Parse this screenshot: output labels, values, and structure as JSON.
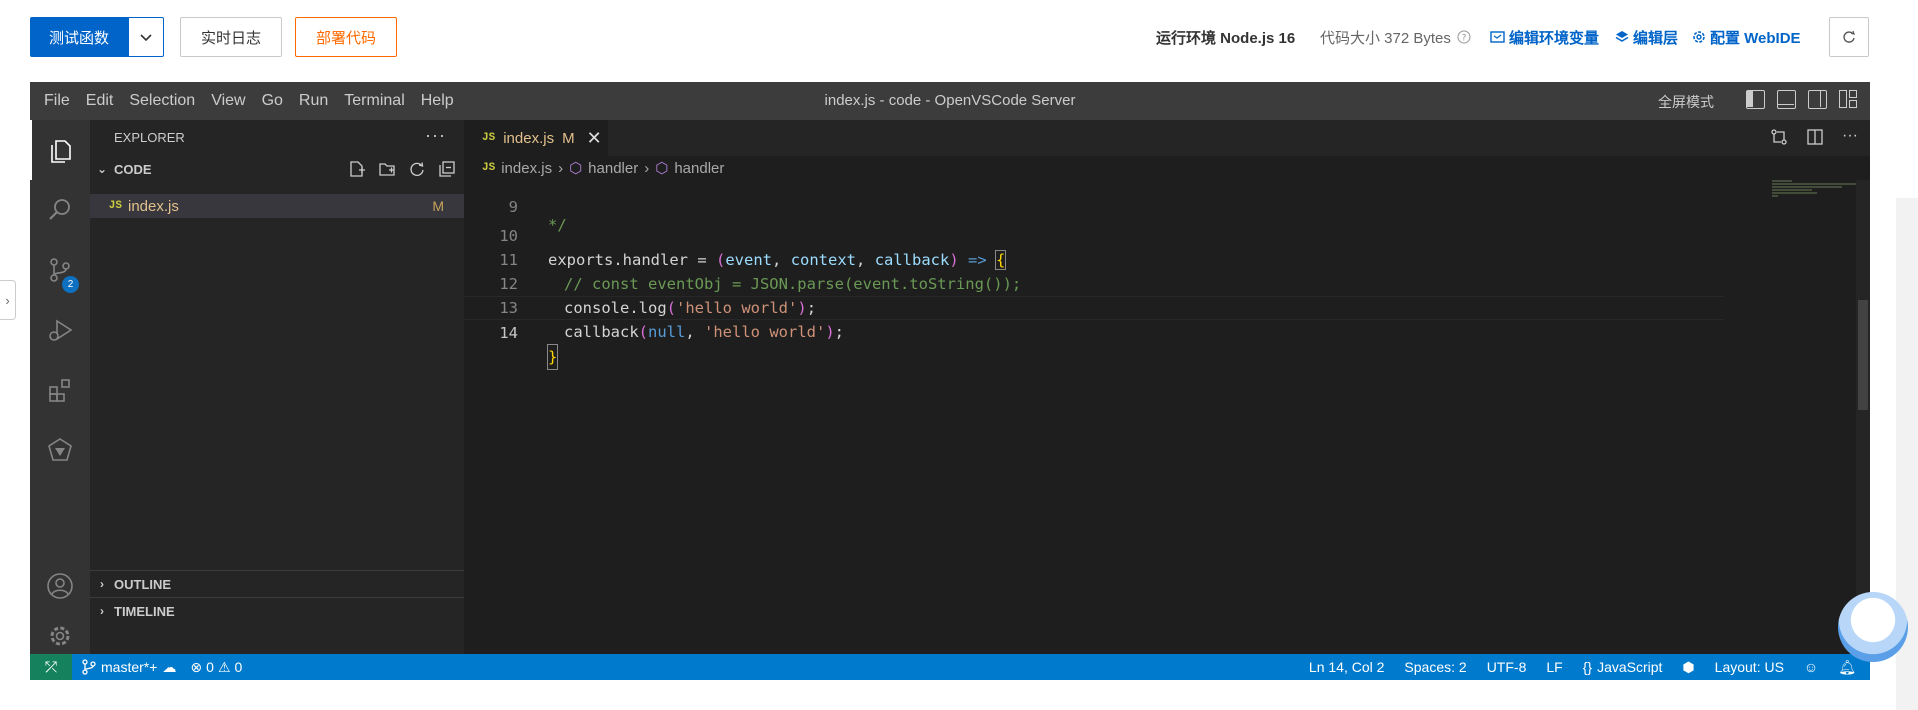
{
  "toolbar": {
    "test_function": "测试函数",
    "realtime_log": "实时日志",
    "deploy_code": "部署代码",
    "runtime": "运行环境 Node.js 16",
    "code_size": "代码大小 372 Bytes",
    "edit_env": "编辑环境变量",
    "edit_layer": "编辑层",
    "config_webide": "配置 WebIDE"
  },
  "vscode": {
    "menu": [
      "File",
      "Edit",
      "Selection",
      "View",
      "Go",
      "Run",
      "Terminal",
      "Help"
    ],
    "window_title": "index.js - code - OpenVSCode Server",
    "fullscreen": "全屏模式",
    "scm_badge": "2",
    "explorer": {
      "title": "EXPLORER",
      "section": "CODE",
      "file": "index.js",
      "file_status": "M",
      "outline": "OUTLINE",
      "timeline": "TIMELINE"
    },
    "tab": {
      "icon": "JS",
      "label": "index.js",
      "status": "M"
    },
    "breadcrumb": [
      "index.js",
      "handler",
      "handler"
    ],
    "code": {
      "lines": [
        9,
        10,
        11,
        12,
        13,
        14
      ],
      "line_9": "*/",
      "line_11": "// const eventObj = JSON.parse(event.toString());",
      "tok_exports": "exports",
      "tok_handler": "handler",
      "tok_event": "event",
      "tok_context": "context",
      "tok_callback": "callback",
      "tok_console": "console",
      "tok_log": "log",
      "tok_hello": "'hello world'",
      "tok_null": "null"
    },
    "status": {
      "branch": "master*+",
      "errors": "0",
      "warnings": "0",
      "position": "Ln 14, Col 2",
      "spaces": "Spaces: 2",
      "encoding": "UTF-8",
      "eol": "LF",
      "language": "JavaScript",
      "layout": "Layout: US"
    }
  },
  "colors": {
    "primary": "#0064c8",
    "orange": "#ff6a00",
    "statusbar": "#007acc"
  }
}
